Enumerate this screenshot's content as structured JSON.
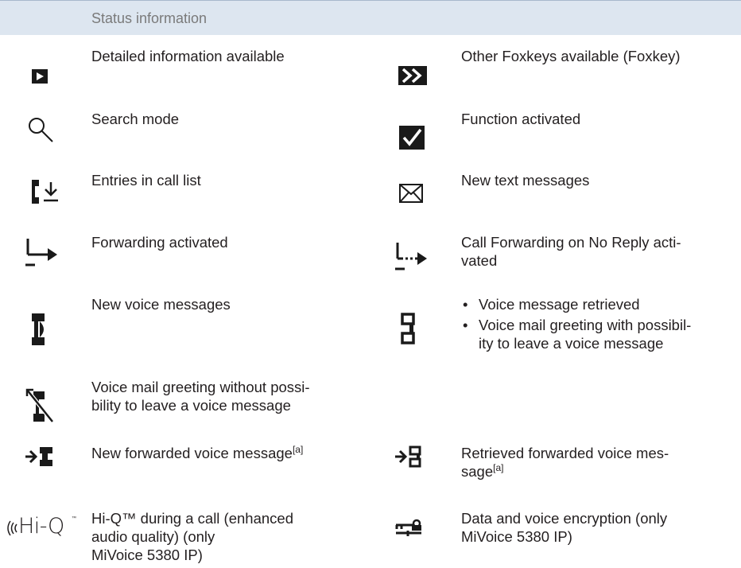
{
  "header": {
    "title": "Status information"
  },
  "rows": [
    {
      "left": {
        "icon": "info-arrow-icon",
        "text": "Detailed information available"
      },
      "right": {
        "icon": "foxkey-more-icon",
        "text": "Other Foxkeys available (Foxkey)"
      }
    },
    {
      "left": {
        "icon": "search-icon",
        "text": "Search mode"
      },
      "right": {
        "icon": "checkmark-icon",
        "text": "Function activated"
      }
    },
    {
      "left": {
        "icon": "call-list-icon",
        "text": "Entries in call list"
      },
      "right": {
        "icon": "envelope-icon",
        "text": "New text messages"
      }
    },
    {
      "left": {
        "icon": "forwarding-icon",
        "text": "Forwarding activated"
      },
      "right": {
        "icon": "forwarding-no-reply-icon",
        "text_line1": "Call Forwarding on No Reply acti-",
        "text_line2": "vated"
      }
    },
    {
      "left": {
        "icon": "voice-message-icon",
        "text": "New voice messages"
      },
      "right": {
        "icon": "voice-message-retrieved-icon",
        "bullets": [
          {
            "line1": "Voice message retrieved"
          },
          {
            "line1": "Voice mail greeting with possibil-",
            "line2": "ity to leave a voice message"
          }
        ]
      }
    },
    {
      "left": {
        "icon": "voice-mail-no-leave-icon",
        "text_line1": "Voice mail greeting without possi-",
        "text_line2": "bility to leave a voice message"
      }
    },
    {
      "left": {
        "icon": "forwarded-voice-message-icon",
        "text": "New forwarded voice message",
        "sup": "[a]"
      },
      "right": {
        "icon": "retrieved-forwarded-voice-icon",
        "text_line1": "Retrieved forwarded voice mes-",
        "text_line2": "sage",
        "sup": "[a]"
      }
    },
    {
      "left": {
        "icon": "hi-q-logo",
        "logo_text": "Hi-Q",
        "text_line1": "Hi-Q™ during a call (enhanced",
        "text_line2": "audio quality) (only",
        "text_line3": "MiVoice 5380 IP)"
      },
      "right": {
        "icon": "encryption-icon",
        "text_line1": "Data and voice encryption (only",
        "text_line2": "MiVoice 5380 IP)"
      }
    }
  ]
}
